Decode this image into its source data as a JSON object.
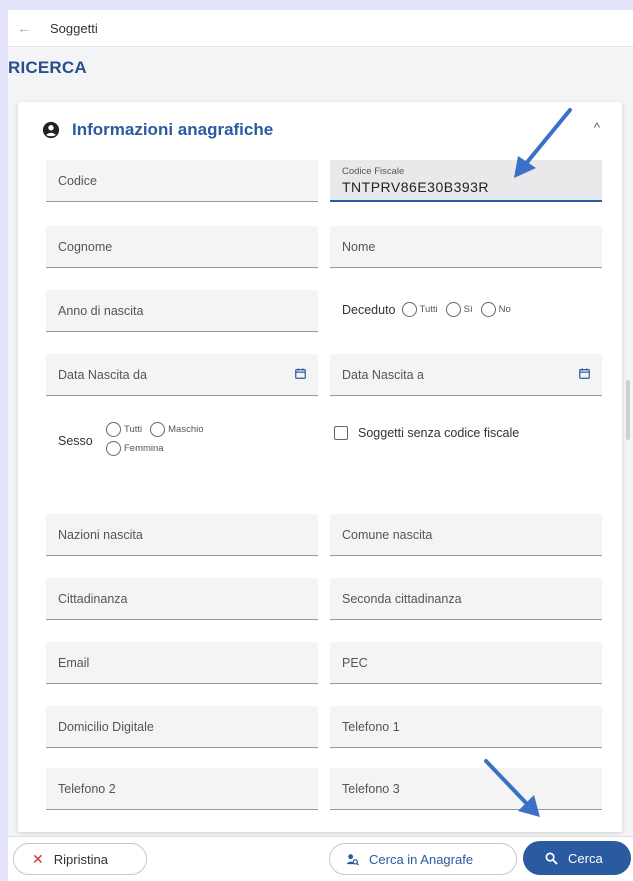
{
  "topbar": {
    "back_icon": "←",
    "title": "Soggetti"
  },
  "section": {
    "title": "RICERCA"
  },
  "panel": {
    "title": "Informazioni anagrafiche",
    "collapse_icon": "^",
    "fields": {
      "codice": "Codice",
      "codice_fiscale_label": "Codice Fiscale",
      "codice_fiscale_value": "TNTPRV86E30B393R",
      "cognome": "Cognome",
      "nome": "Nome",
      "anno_nascita": "Anno di nascita",
      "data_nascita_da": "Data Nascita da",
      "data_nascita_a": "Data Nascita a",
      "nazioni_nascita": "Nazioni nascita",
      "comune_nascita": "Comune nascita",
      "cittadinanza": "Cittadinanza",
      "seconda_cittadinanza": "Seconda cittadinanza",
      "email": "Email",
      "pec": "PEC",
      "domicilio_digitale": "Domicilio Digitale",
      "telefono1": "Telefono 1",
      "telefono2": "Telefono 2",
      "telefono3": "Telefono 3"
    },
    "deceduto": {
      "label": "Deceduto",
      "options": [
        "Tutti",
        "Sì",
        "No"
      ]
    },
    "sesso": {
      "label": "Sesso",
      "options": [
        "Tutti",
        "Maschio",
        "Femmina"
      ]
    },
    "senza_cf": {
      "label": "Soggetti senza codice fiscale"
    }
  },
  "actions": {
    "reset_icon": "✕",
    "reset_label": "Ripristina",
    "anagrafe_label": "Cerca in Anagrafe",
    "search_label": "Cerca"
  },
  "colors": {
    "accent": "#2a5aa0",
    "background": "#e3e4fb"
  }
}
